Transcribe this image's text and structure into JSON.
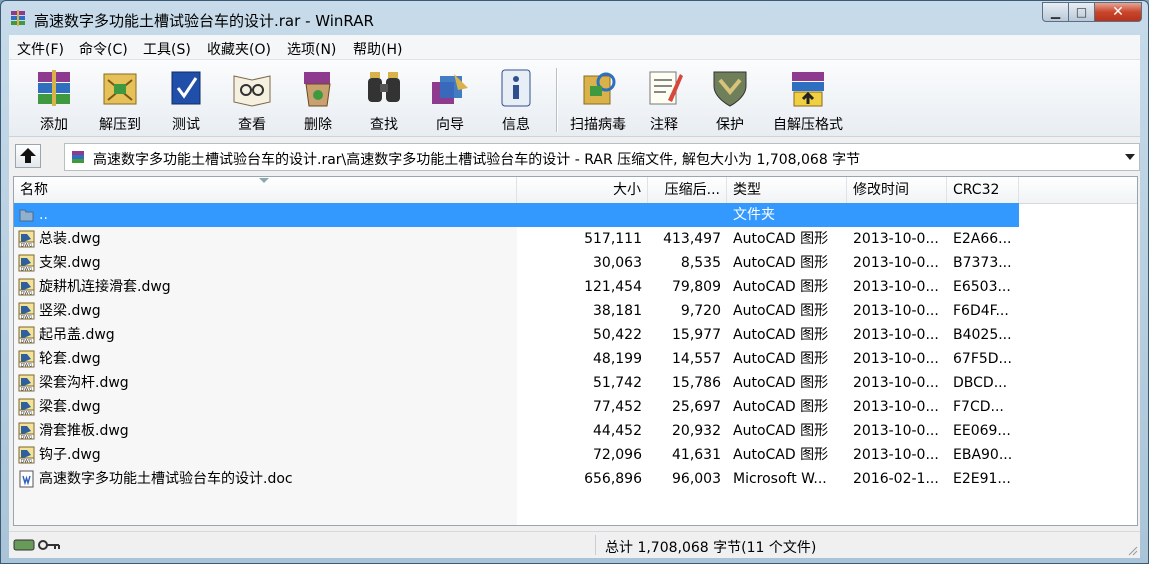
{
  "window": {
    "title": "高速数字多功能土槽试验台车的设计.rar - WinRAR"
  },
  "menu": [
    "文件(F)",
    "命令(C)",
    "工具(S)",
    "收藏夹(O)",
    "选项(N)",
    "帮助(H)"
  ],
  "toolbar": [
    {
      "label": "添加",
      "icon": "add-archive-icon"
    },
    {
      "label": "解压到",
      "icon": "extract-to-icon"
    },
    {
      "label": "测试",
      "icon": "test-icon"
    },
    {
      "label": "查看",
      "icon": "view-icon"
    },
    {
      "label": "删除",
      "icon": "delete-icon"
    },
    {
      "label": "查找",
      "icon": "find-icon"
    },
    {
      "label": "向导",
      "icon": "wizard-icon"
    },
    {
      "label": "信息",
      "icon": "info-icon"
    },
    {
      "label": "扫描病毒",
      "icon": "virus-scan-icon"
    },
    {
      "label": "注释",
      "icon": "comment-icon"
    },
    {
      "label": "保护",
      "icon": "protect-icon"
    },
    {
      "label": "自解压格式",
      "icon": "sfx-icon"
    }
  ],
  "address": {
    "path": "高速数字多功能土槽试验台车的设计.rar\\高速数字多功能土槽试验台车的设计 - RAR 压缩文件, 解包大小为 1,708,068 字节"
  },
  "columns": [
    "名称",
    "大小",
    "压缩后...",
    "类型",
    "修改时间",
    "CRC32"
  ],
  "files": [
    {
      "name": "..",
      "size": "",
      "packed": "",
      "type": "文件夹",
      "modified": "",
      "crc": "",
      "icon": "folder-up-icon",
      "selected": true
    },
    {
      "name": "总装.dwg",
      "size": "517,111",
      "packed": "413,497",
      "type": "AutoCAD 图形",
      "modified": "2013-10-0...",
      "crc": "E2A66...",
      "icon": "dwg-file-icon"
    },
    {
      "name": "支架.dwg",
      "size": "30,063",
      "packed": "8,535",
      "type": "AutoCAD 图形",
      "modified": "2013-10-0...",
      "crc": "B7373...",
      "icon": "dwg-file-icon"
    },
    {
      "name": "旋耕机连接滑套.dwg",
      "size": "121,454",
      "packed": "79,809",
      "type": "AutoCAD 图形",
      "modified": "2013-10-0...",
      "crc": "E6503...",
      "icon": "dwg-file-icon"
    },
    {
      "name": "竖梁.dwg",
      "size": "38,181",
      "packed": "9,720",
      "type": "AutoCAD 图形",
      "modified": "2013-10-0...",
      "crc": "F6D4F...",
      "icon": "dwg-file-icon"
    },
    {
      "name": "起吊盖.dwg",
      "size": "50,422",
      "packed": "15,977",
      "type": "AutoCAD 图形",
      "modified": "2013-10-0...",
      "crc": "B4025...",
      "icon": "dwg-file-icon"
    },
    {
      "name": "轮套.dwg",
      "size": "48,199",
      "packed": "14,557",
      "type": "AutoCAD 图形",
      "modified": "2013-10-0...",
      "crc": "67F5D...",
      "icon": "dwg-file-icon"
    },
    {
      "name": "梁套沟杆.dwg",
      "size": "51,742",
      "packed": "15,786",
      "type": "AutoCAD 图形",
      "modified": "2013-10-0...",
      "crc": "DBCD...",
      "icon": "dwg-file-icon"
    },
    {
      "name": "梁套.dwg",
      "size": "77,452",
      "packed": "25,697",
      "type": "AutoCAD 图形",
      "modified": "2013-10-0...",
      "crc": "F7CD...",
      "icon": "dwg-file-icon"
    },
    {
      "name": "滑套推板.dwg",
      "size": "44,452",
      "packed": "20,932",
      "type": "AutoCAD 图形",
      "modified": "2013-10-0...",
      "crc": "EE069...",
      "icon": "dwg-file-icon"
    },
    {
      "name": "钩子.dwg",
      "size": "72,096",
      "packed": "41,631",
      "type": "AutoCAD 图形",
      "modified": "2013-10-0...",
      "crc": "EBA90...",
      "icon": "dwg-file-icon"
    },
    {
      "name": "高速数字多功能土槽试验台车的设计.doc",
      "size": "656,896",
      "packed": "96,003",
      "type": "Microsoft W...",
      "modified": "2016-02-1...",
      "crc": "E2E91...",
      "icon": "word-file-icon"
    }
  ],
  "status": {
    "text": "总计 1,708,068 字节(11 个文件)"
  },
  "colors": {
    "selection": "#3399ff",
    "close_button": "#c8462c"
  }
}
